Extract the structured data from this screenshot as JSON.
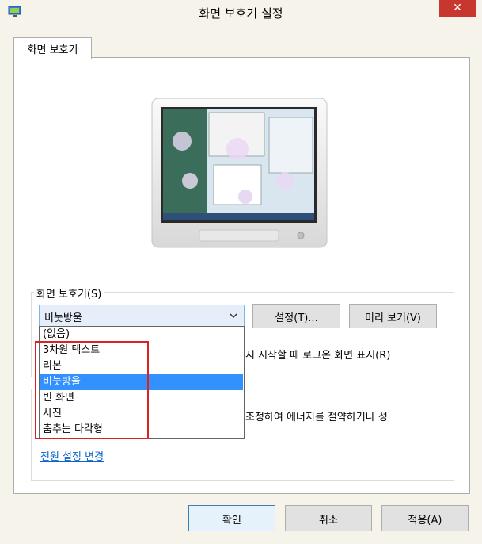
{
  "window": {
    "title": "화면 보호기 설정",
    "close_label": "✕"
  },
  "tabs": [
    {
      "label": "화면 보호기"
    }
  ],
  "screensaver": {
    "group_label": "화면 보호기(S)",
    "selected": "비눗방울",
    "options": [
      "(없음)",
      "3차원 텍스트",
      "리본",
      "비눗방울",
      "빈 화면",
      "사진",
      "춤추는 다각형"
    ],
    "settings_button": "설정(T)...",
    "preview_button": "미리 보기(V)",
    "resume_text": "시 시작할 때 로그온 화면 표시(R)"
  },
  "power": {
    "description": "조정하여 에너지를 절약하거나 성",
    "link": "전원 설정 변경"
  },
  "footer": {
    "ok": "확인",
    "cancel": "취소",
    "apply": "적용(A)"
  },
  "colors": {
    "accent_selected": "#3390ff",
    "close_red": "#c7372f",
    "annotation_red": "#e02020",
    "link": "#0a64c8"
  }
}
